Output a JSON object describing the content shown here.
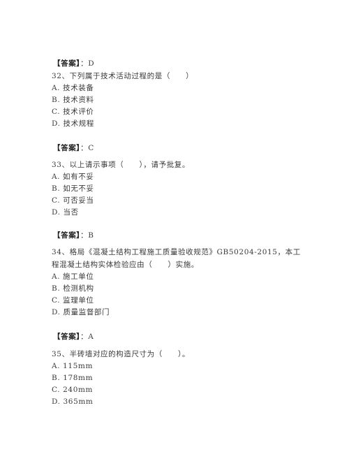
{
  "blocks": [
    {
      "answer_label": "【答案】",
      "answer_sep": "：",
      "answer_value": "D"
    },
    {
      "question": "32、下列属于技术活动过程的是（　　）",
      "options": [
        "A. 技术装备",
        "B. 技术资料",
        "C. 技术评价",
        "D. 技术规程"
      ],
      "answer_label": "【答案】",
      "answer_sep": "：",
      "answer_value": "C"
    },
    {
      "question": "33、以上请示事项（　　），请予批复。",
      "options": [
        "A. 如有不妥",
        "B. 如无不妥",
        "C. 可否妥当",
        "D. 当否"
      ],
      "answer_label": "【答案】",
      "answer_sep": "：",
      "answer_value": "B"
    },
    {
      "question_lines": [
        "34、格局《混凝土结构工程施工质量验收规范》GB50204-2015，本工",
        "程混凝土结构实体检验应由（　　）实施。"
      ],
      "options": [
        "A. 施工单位",
        "B. 检测机构",
        "C. 监理单位",
        "D. 质量监督部门"
      ],
      "answer_label": "【答案】",
      "answer_sep": "：",
      "answer_value": "A"
    },
    {
      "question": "35、半砖墙对应的构造尺寸为（　　）。",
      "options": [
        "A. 115mm",
        "B. 178mm",
        "C. 240mm",
        "D. 365mm"
      ]
    }
  ]
}
